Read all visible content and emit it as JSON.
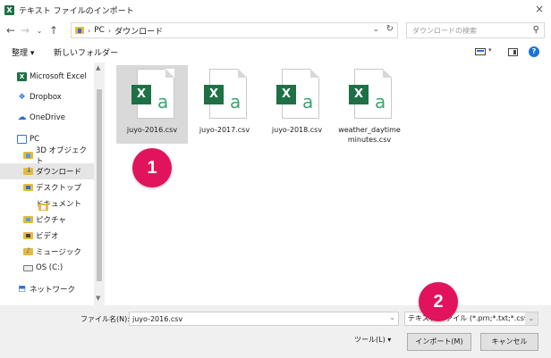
{
  "window": {
    "title": "テキスト ファイルのインポート",
    "close_glyph": "×",
    "app_icon_letter": "X"
  },
  "address": {
    "crumbs": [
      "PC",
      "ダウンロード"
    ],
    "separator": "›",
    "search_placeholder": "ダウンロードの検索"
  },
  "toolbar": {
    "organize_label": "整理 ▾",
    "new_folder_label": "新しいフォルダー",
    "help_glyph": "?"
  },
  "sidebar": {
    "items": [
      {
        "label": "Microsoft Excel",
        "icon": "excel-icon"
      },
      {
        "label": "Dropbox",
        "icon": "dropbox-icon"
      },
      {
        "label": "OneDrive",
        "icon": "onedrive-icon"
      },
      {
        "label": "PC",
        "icon": "pc-icon"
      },
      {
        "label": "3D オブジェクト",
        "icon": "folder-3d-icon"
      },
      {
        "label": "ダウンロード",
        "icon": "folder-download-icon"
      },
      {
        "label": "デスクトップ",
        "icon": "folder-desktop-icon"
      },
      {
        "label": "ドキュメント",
        "icon": "folder-documents-icon"
      },
      {
        "label": "ピクチャ",
        "icon": "folder-pictures-icon"
      },
      {
        "label": "ビデオ",
        "icon": "folder-videos-icon"
      },
      {
        "label": "ミュージック",
        "icon": "folder-music-icon"
      },
      {
        "label": "OS (C:)",
        "icon": "drive-icon"
      },
      {
        "label": "ネットワーク",
        "icon": "network-icon"
      }
    ],
    "selected": "ダウンロード"
  },
  "files": [
    {
      "name": "juyo-2016.csv",
      "selected": true
    },
    {
      "name": "juyo-2017.csv",
      "selected": false
    },
    {
      "name": "juyo-2018.csv",
      "selected": false
    },
    {
      "name": "weather_daytime minutes.csv",
      "selected": false
    }
  ],
  "file_icon": {
    "badge_letter": "X",
    "glyph": "a"
  },
  "bottom": {
    "filename_label": "ファイル名(N):",
    "filename_value": "juyo-2016.csv",
    "filetype_value": "テキスト ファイル (*.prn;*.txt;*.csv)",
    "tools_label": "ツール(L) ▾",
    "import_label": "インポート(M)",
    "cancel_label": "キャンセル"
  },
  "callouts": [
    {
      "number": "1"
    },
    {
      "number": "2"
    }
  ],
  "colors": {
    "callout": "#e0135c",
    "excel_green": "#1e7145",
    "selection": "#d9d9d9"
  }
}
